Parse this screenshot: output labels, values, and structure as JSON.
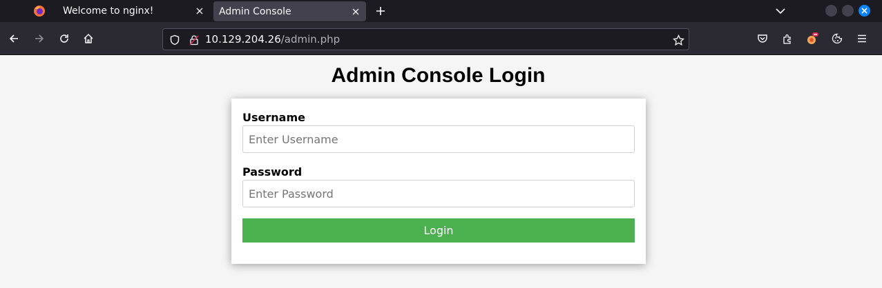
{
  "browser": {
    "tabs": [
      {
        "label": "Welcome to nginx!",
        "active": false
      },
      {
        "label": "Admin Console",
        "active": true
      }
    ],
    "url": {
      "host": "10.129.204.26",
      "path": "/admin.php"
    }
  },
  "page": {
    "title": "Admin Console Login",
    "username": {
      "label": "Username",
      "placeholder": "Enter Username",
      "value": ""
    },
    "password": {
      "label": "Password",
      "placeholder": "Enter Password",
      "value": ""
    },
    "login_label": "Login"
  },
  "colors": {
    "login_button": "#4caf50",
    "accent": "#0a84ff"
  }
}
